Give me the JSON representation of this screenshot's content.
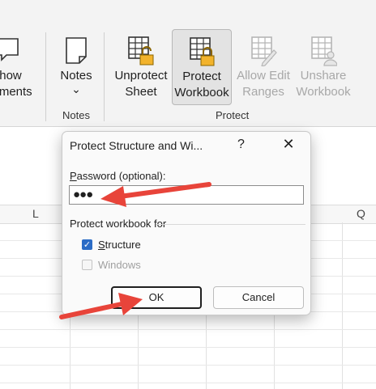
{
  "ribbon": {
    "show_comments": {
      "line1": "how",
      "line2": "mments"
    },
    "notes": {
      "label": "Notes",
      "chevron": "⌄"
    },
    "unprotect_sheet": {
      "line1": "Unprotect",
      "line2": "Sheet"
    },
    "protect_workbook": {
      "line1": "Protect",
      "line2": "Workbook"
    },
    "allow_edit_ranges": {
      "line1": "Allow Edit",
      "line2": "Ranges"
    },
    "unshare_workbook": {
      "line1": "Unshare",
      "line2": "Workbook"
    },
    "groups": {
      "notes": "Notes",
      "protect": "Protect"
    },
    "lock_color": "#f2b32c"
  },
  "sheet": {
    "columns": {
      "l": "L",
      "q": "Q"
    }
  },
  "dialog": {
    "title": "Protect Structure and Wi...",
    "help": "?",
    "close": "✕",
    "password_label_access": "P",
    "password_label_rest": "assword (optional):",
    "password_value": "●●●",
    "section_label": "Protect workbook for",
    "structure_access": "S",
    "structure_rest": "tructure",
    "structure_checked": true,
    "windows_label": "Windows",
    "windows_checked": false,
    "ok_label": "OK",
    "cancel_label": "Cancel",
    "accent_color": "#2b6cc6"
  },
  "annotation": {
    "arrow_color": "#e8443a"
  }
}
